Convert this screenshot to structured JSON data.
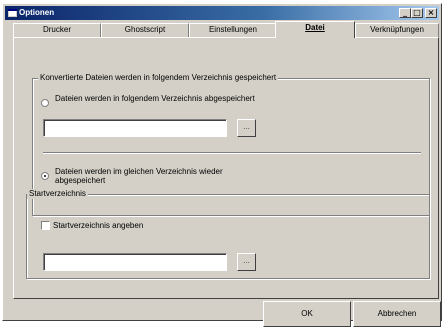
{
  "window": {
    "title": "Optionen",
    "app_icon": "window-app-icon",
    "minimize_glyph": "_",
    "maximize_glyph": "□",
    "close_glyph": "×"
  },
  "tabs": [
    {
      "label": "Drucker",
      "active": false
    },
    {
      "label": "Ghostscript",
      "active": false
    },
    {
      "label": "Einstellungen",
      "active": false
    },
    {
      "label": "Datei",
      "active": true
    },
    {
      "label": "Verknüpfungen",
      "active": false
    }
  ],
  "convert_group": {
    "caption": "Konvertierte Dateien werden in folgendem Verzeichnis gespeichert",
    "option_folder": "Dateien werden in folgendem Verzeichnis abgespeichert",
    "folder_value": "",
    "browse_label": "...",
    "option_same": "Dateien werden im gleichen Verzeichnis wieder abgespeichert",
    "selected": "same"
  },
  "start_group": {
    "caption": "Startverzeichnis",
    "checkbox_label": "Startverzeichnis angeben",
    "checked": false,
    "folder_value": "",
    "browse_label": "..."
  },
  "footer": {
    "ok_label": "OK",
    "cancel_label": "Abbrechen"
  }
}
